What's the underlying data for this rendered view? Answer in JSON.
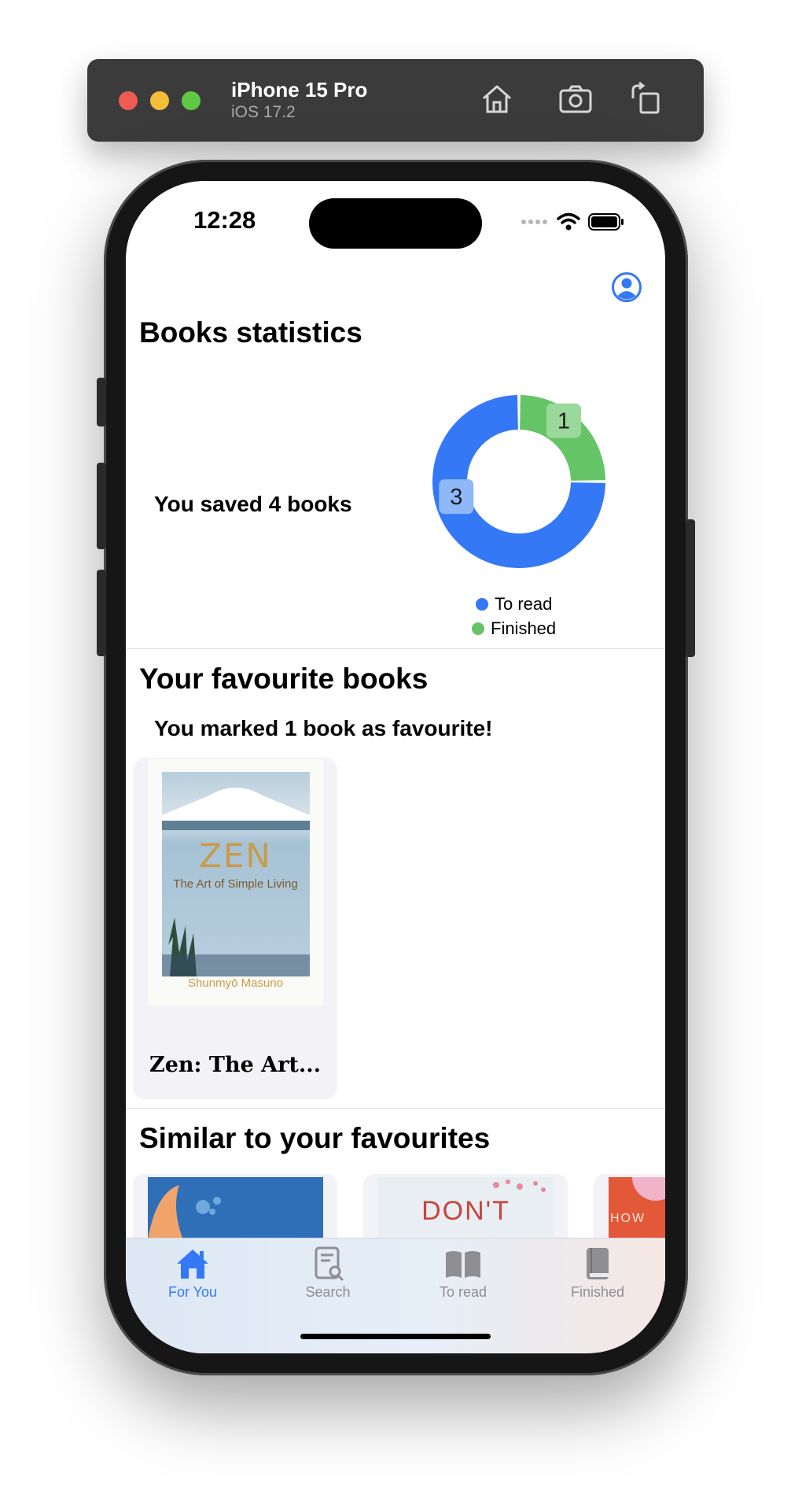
{
  "simulator": {
    "device_name": "iPhone 15 Pro",
    "os_version": "iOS 17.2"
  },
  "status_bar": {
    "time": "12:28"
  },
  "stats": {
    "title": "Books statistics",
    "saved_text": "You saved 4 books",
    "legend": [
      {
        "label": "To read",
        "color": "#3478f6"
      },
      {
        "label": "Finished",
        "color": "#65c466"
      }
    ],
    "chart_labels": {
      "to_read": "3",
      "finished": "1"
    }
  },
  "chart_data": {
    "type": "pie",
    "categories": [
      "To read",
      "Finished"
    ],
    "values": [
      3,
      1
    ],
    "colors": [
      "#3478f6",
      "#65c466"
    ],
    "donut": true,
    "legend_position": "bottom"
  },
  "favourites": {
    "title": "Your favourite books",
    "message": "You marked 1 book as favourite!",
    "books": [
      {
        "title": "Zen: The Art...",
        "cover_title": "ZEN",
        "cover_subtitle": "The Art of Simple Living",
        "cover_author": "Shunmyō Masuno"
      }
    ]
  },
  "similar": {
    "title": "Similar to your favourites",
    "covers": [
      {
        "text": "",
        "color": "#2f6fb8"
      },
      {
        "text": "DON'T",
        "color": "#e9eef3"
      },
      {
        "text": "HOW",
        "color": "#e4583a"
      }
    ]
  },
  "tabbar": {
    "tabs": [
      {
        "label": "For You",
        "icon": "house-icon",
        "selected": true
      },
      {
        "label": "Search",
        "icon": "search-doc-icon",
        "selected": false
      },
      {
        "label": "To read",
        "icon": "open-book-icon",
        "selected": false
      },
      {
        "label": "Finished",
        "icon": "closed-book-icon",
        "selected": false
      }
    ]
  },
  "colors": {
    "accent": "#3478f6",
    "finished": "#65c466",
    "tab_inactive": "#8e8e93"
  }
}
